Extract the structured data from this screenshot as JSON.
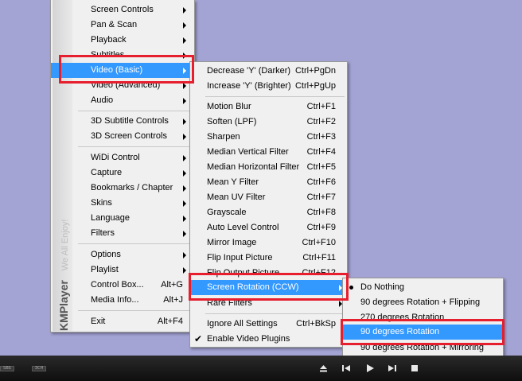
{
  "main_menu": {
    "brand": "KMPlayer",
    "tagline": "We All Enjoy!",
    "items": [
      {
        "label": "Screen Controls",
        "shortcut": "",
        "submenu": true
      },
      {
        "label": "Pan & Scan",
        "shortcut": "",
        "submenu": true
      },
      {
        "label": "Playback",
        "shortcut": "",
        "submenu": true
      },
      {
        "label": "Subtitles",
        "shortcut": "",
        "submenu": true
      },
      {
        "label": "Video (Basic)",
        "shortcut": "",
        "submenu": true
      },
      {
        "label": "Video (Advanced)",
        "shortcut": "",
        "submenu": true
      },
      {
        "label": "Audio",
        "shortcut": "",
        "submenu": true
      },
      {
        "label": "3D Subtitle Controls",
        "shortcut": "",
        "submenu": true
      },
      {
        "label": "3D Screen Controls",
        "shortcut": "",
        "submenu": true
      },
      {
        "label": "WiDi Control",
        "shortcut": "",
        "submenu": true
      },
      {
        "label": "Capture",
        "shortcut": "",
        "submenu": true
      },
      {
        "label": "Bookmarks / Chapter",
        "shortcut": "",
        "submenu": true
      },
      {
        "label": "Skins",
        "shortcut": "",
        "submenu": true
      },
      {
        "label": "Language",
        "shortcut": "",
        "submenu": true
      },
      {
        "label": "Filters",
        "shortcut": "",
        "submenu": true
      },
      {
        "label": "Options",
        "shortcut": "",
        "submenu": true
      },
      {
        "label": "Playlist",
        "shortcut": "",
        "submenu": true
      },
      {
        "label": "Control Box...",
        "shortcut": "Alt+G",
        "submenu": false
      },
      {
        "label": "Media Info...",
        "shortcut": "Alt+J",
        "submenu": false
      },
      {
        "label": "Exit",
        "shortcut": "Alt+F4",
        "submenu": false
      }
    ]
  },
  "video_menu": {
    "items": [
      {
        "label": "Decrease 'Y' (Darker)",
        "shortcut": "Ctrl+PgDn"
      },
      {
        "label": "Increase 'Y' (Brighter)",
        "shortcut": "Ctrl+PgUp"
      },
      {
        "label": "Motion Blur",
        "shortcut": "Ctrl+F1"
      },
      {
        "label": "Soften (LPF)",
        "shortcut": "Ctrl+F2"
      },
      {
        "label": "Sharpen",
        "shortcut": "Ctrl+F3"
      },
      {
        "label": "Median Vertical Filter",
        "shortcut": "Ctrl+F4"
      },
      {
        "label": "Median Horizontal Filter",
        "shortcut": "Ctrl+F5"
      },
      {
        "label": "Mean Y Filter",
        "shortcut": "Ctrl+F6"
      },
      {
        "label": "Mean UV Filter",
        "shortcut": "Ctrl+F7"
      },
      {
        "label": "Grayscale",
        "shortcut": "Ctrl+F8"
      },
      {
        "label": "Auto Level Control",
        "shortcut": "Ctrl+F9"
      },
      {
        "label": "Mirror Image",
        "shortcut": "Ctrl+F10"
      },
      {
        "label": "Flip Input Picture",
        "shortcut": "Ctrl+F11"
      },
      {
        "label": "Flip Output Picture",
        "shortcut": "Ctrl+F12"
      },
      {
        "label": "Screen Rotation (CCW)",
        "shortcut": ""
      },
      {
        "label": "Rare Filters",
        "shortcut": ""
      },
      {
        "label": "Ignore All Settings",
        "shortcut": "Ctrl+BkSp"
      },
      {
        "label": "Enable Video Plugins",
        "shortcut": ""
      }
    ]
  },
  "rotation_menu": {
    "items": [
      {
        "label": "Do Nothing"
      },
      {
        "label": "90 degrees Rotation + Flipping"
      },
      {
        "label": "270 degrees Rotation"
      },
      {
        "label": "90 degrees Rotation"
      },
      {
        "label": "90 degrees Rotation + Mirroring"
      }
    ]
  },
  "control_bar": {
    "left_badges": [
      "SBS",
      "3CH"
    ],
    "buttons": [
      "eject-icon",
      "previous-icon",
      "play-icon",
      "next-icon",
      "stop-icon"
    ]
  },
  "colors": {
    "background": "#a3a3d4",
    "menu_bg": "#f0f0f0",
    "highlight": "#3399ff",
    "annotation_red": "#e61e2e"
  }
}
